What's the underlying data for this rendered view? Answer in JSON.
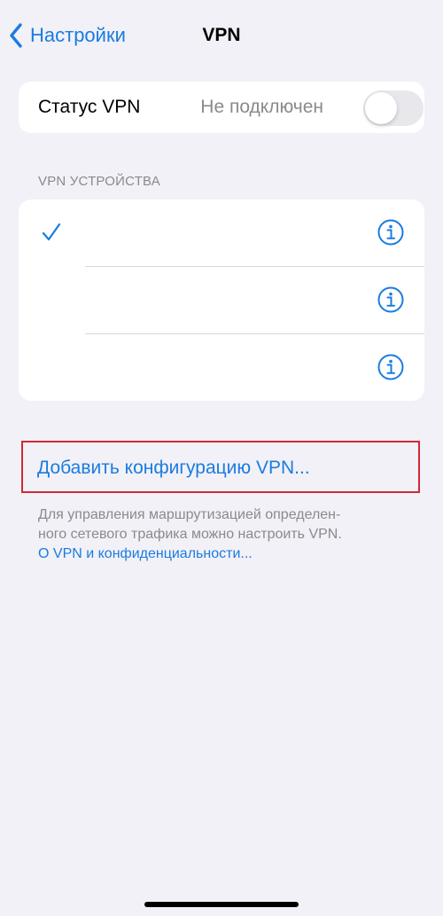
{
  "nav": {
    "back_label": "Настройки",
    "title": "VPN"
  },
  "status": {
    "label": "Статус VPN",
    "value": "Не подключен",
    "toggle_on": false
  },
  "devices": {
    "header": "VPN УСТРОЙСТВА",
    "items": [
      {
        "name": "",
        "selected": true
      },
      {
        "name": "",
        "selected": false
      },
      {
        "name": "",
        "selected": false
      }
    ]
  },
  "add": {
    "label": "Добавить конфигурацию VPN..."
  },
  "footer": {
    "line1": "Для управления маршрутизацией определен-",
    "line2": "ного сетевого трафика можно настроить VPN.",
    "link": "О VPN и конфиденциальности..."
  },
  "colors": {
    "accent": "#1a7ce0",
    "background": "#f2f1f7",
    "highlight": "#d0283a"
  },
  "icons": {
    "back": "chevron-left-icon",
    "check": "checkmark-icon",
    "info": "info-circle-icon"
  }
}
